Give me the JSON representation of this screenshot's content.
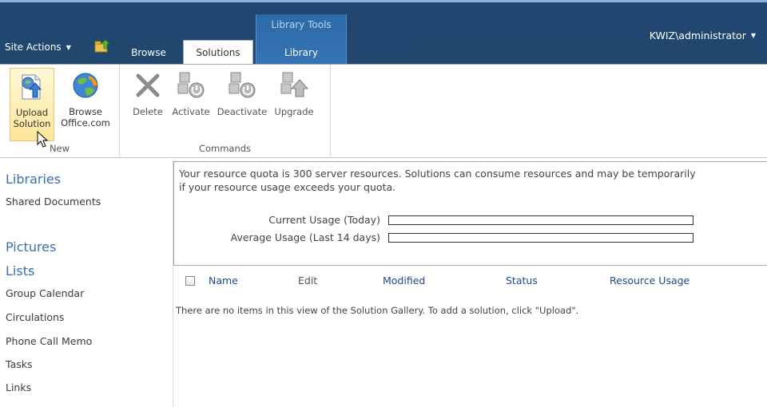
{
  "topbar": {
    "site_actions_label": "Site Actions",
    "tabs": {
      "browse": "Browse",
      "solutions": "Solutions",
      "library": "Library"
    },
    "library_tools_label": "Library Tools",
    "user": "KWIZ\\administrator"
  },
  "ribbon": {
    "groups": {
      "new": {
        "label": "New",
        "buttons": {
          "upload": {
            "line1": "Upload",
            "line2": "Solution"
          },
          "office": {
            "line1": "Browse",
            "line2": "Office.com"
          }
        }
      },
      "commands": {
        "label": "Commands",
        "buttons": {
          "delete": "Delete",
          "activate": "Activate",
          "deactivate": "Deactivate",
          "upgrade": "Upgrade"
        }
      }
    }
  },
  "leftnav": {
    "libraries_heading": "Libraries",
    "shared_documents": "Shared Documents",
    "pictures_heading": "Pictures",
    "lists_heading": "Lists",
    "lists": [
      "Group Calendar",
      "Circulations",
      "Phone Call Memo",
      "Tasks",
      "Links"
    ]
  },
  "quota": {
    "line1": "Your resource quota is 300 server resources. Solutions can consume resources and may be temporarily",
    "line2": "if your resource usage exceeds your quota.",
    "current_label": "Current Usage (Today)",
    "average_label": "Average Usage (Last 14 days)",
    "current_fraction": 0,
    "average_fraction": 0
  },
  "list": {
    "columns": {
      "name": "Name",
      "edit": "Edit",
      "modified": "Modified",
      "status": "Status",
      "resource_usage": "Resource Usage"
    },
    "empty_message": "There are no items in this view of the Solution Gallery. To add a solution, click \"Upload\"."
  },
  "colors": {
    "topbar": "#21476f",
    "library_tools": "#3473b5",
    "nav_heading": "#3a6fb0",
    "link": "#224a86"
  }
}
